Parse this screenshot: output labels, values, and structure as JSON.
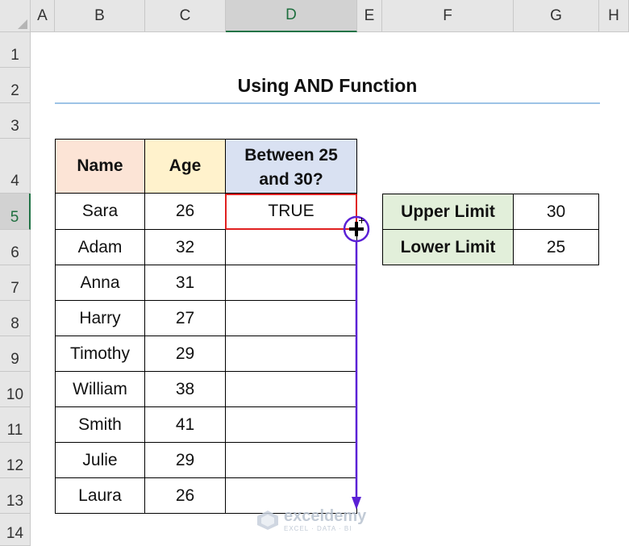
{
  "columns": [
    "A",
    "B",
    "C",
    "D",
    "E",
    "F",
    "G",
    "H"
  ],
  "rows": [
    "1",
    "2",
    "3",
    "4",
    "5",
    "6",
    "7",
    "8",
    "9",
    "10",
    "11",
    "12",
    "13",
    "14"
  ],
  "active_column": "D",
  "active_row": "5",
  "title": "Using AND Function",
  "table": {
    "headers": {
      "name": "Name",
      "age": "Age",
      "between": "Between 25 and 30?"
    },
    "rows": [
      {
        "name": "Sara",
        "age": "26",
        "between": "TRUE"
      },
      {
        "name": "Adam",
        "age": "32",
        "between": ""
      },
      {
        "name": "Anna",
        "age": "31",
        "between": ""
      },
      {
        "name": "Harry",
        "age": "27",
        "between": ""
      },
      {
        "name": "Timothy",
        "age": "29",
        "between": ""
      },
      {
        "name": "William",
        "age": "38",
        "between": ""
      },
      {
        "name": "Smith",
        "age": "41",
        "between": ""
      },
      {
        "name": "Julie",
        "age": "29",
        "between": ""
      },
      {
        "name": "Laura",
        "age": "26",
        "between": ""
      }
    ]
  },
  "limits": [
    {
      "label": "Upper Limit",
      "value": "30"
    },
    {
      "label": "Lower Limit",
      "value": "25"
    }
  ],
  "colors": {
    "name_header_bg": "#fce4d6",
    "age_header_bg": "#fff2cc",
    "between_header_bg": "#d9e1f2",
    "limit_label_bg": "#e2efda",
    "selection": "#e02020",
    "annotation": "#5b21d6"
  },
  "icons": {
    "cursor": "fill-handle-crosshair-icon",
    "watermark": "exceldemy-logo-icon"
  },
  "watermark": {
    "name": "exceldemy",
    "tagline": "EXCEL · DATA · BI"
  }
}
